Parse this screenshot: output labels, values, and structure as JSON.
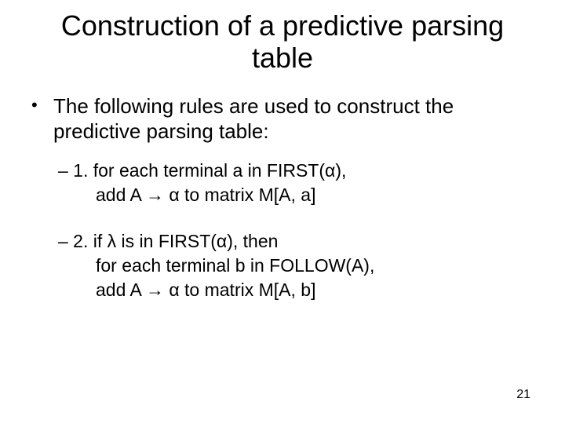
{
  "title": "Construction of a predictive parsing table",
  "intro": "The following rules are used to construct the predictive parsing table:",
  "rule1": {
    "line1_pre": "– 1. for each terminal a in ",
    "line1_first": "FIRST(α)",
    "line1_post": ",",
    "line2_pre": "add A → α   to matrix ",
    "line2_m": "M[A, a]"
  },
  "rule2": {
    "line1": "– 2. if λ is in FIRST(α), then",
    "line2_pre": "for each terminal b in ",
    "line2_follow": "FOLLOW(A)",
    "line2_post": ",",
    "line3_pre": "add A → α   to matrix ",
    "line3_m": "M[A, b]"
  },
  "page_number": "21",
  "bullet_marker": "•"
}
